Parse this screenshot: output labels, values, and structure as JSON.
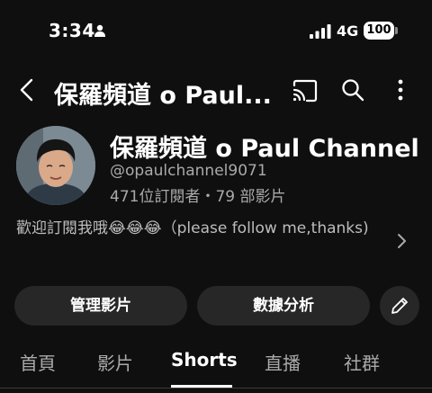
{
  "status_bar": {
    "time": "3:34",
    "network": "4G",
    "battery": "100",
    "icons": [
      "person-icon",
      "signal-icon"
    ]
  },
  "app_bar": {
    "title": "保羅頻道 o Paul...",
    "icons": [
      "back-icon",
      "cast-icon",
      "search-icon",
      "more-vert-icon"
    ]
  },
  "channel": {
    "name": "保羅頻道 o Paul Channel",
    "handle": "@opaulchannel9071",
    "stats": "471位訂閱者・79 部影片",
    "description": "歡迎訂閱我哦😂😂😂（please follow me,thanks)"
  },
  "actions": {
    "manage": "管理影片",
    "analytics": "數據分析",
    "edit_icon": "pencil-icon"
  },
  "tabs": [
    {
      "label": "首頁",
      "active": false
    },
    {
      "label": "影片",
      "active": false
    },
    {
      "label": "Shorts",
      "active": true
    },
    {
      "label": "直播",
      "active": false
    },
    {
      "label": "社群",
      "active": false
    }
  ],
  "colors": {
    "background": "#0f0f0f",
    "button_bg": "#272727",
    "secondary_text": "#aaaaaa"
  }
}
